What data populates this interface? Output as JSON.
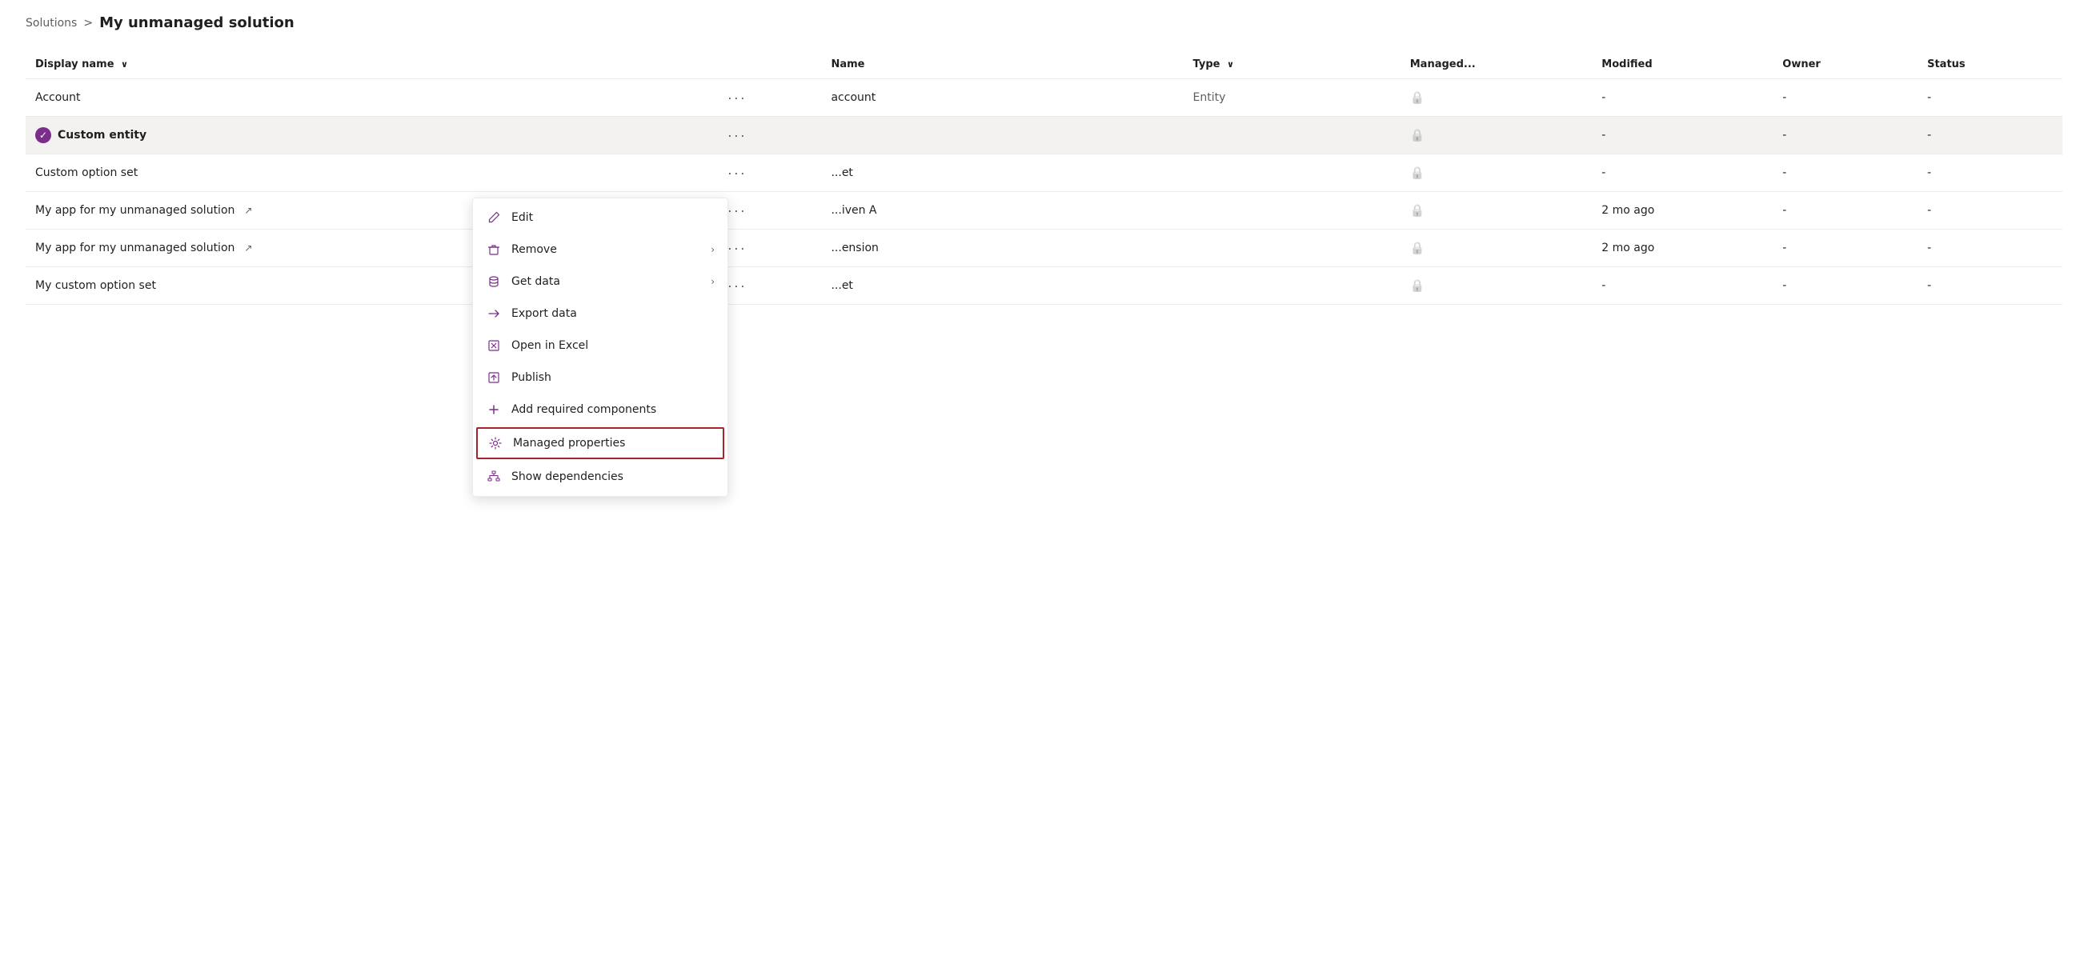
{
  "breadcrumb": {
    "solutions_label": "Solutions",
    "separator": ">",
    "current_label": "My unmanaged solution"
  },
  "table": {
    "columns": [
      {
        "id": "display_name",
        "label": "Display name",
        "sortable": true
      },
      {
        "id": "dots",
        "label": ""
      },
      {
        "id": "name",
        "label": "Name"
      },
      {
        "id": "type",
        "label": "Type",
        "sortable": true
      },
      {
        "id": "managed",
        "label": "Managed..."
      },
      {
        "id": "modified",
        "label": "Modified"
      },
      {
        "id": "owner",
        "label": "Owner"
      },
      {
        "id": "status",
        "label": "Status"
      }
    ],
    "rows": [
      {
        "id": "row-account",
        "display_name": "Account",
        "has_external": false,
        "selected": false,
        "dots": "···",
        "name": "account",
        "type": "Entity",
        "managed_lock": true,
        "modified": "-",
        "owner": "-",
        "status": "-"
      },
      {
        "id": "row-custom-entity",
        "display_name": "Custom entity",
        "has_external": false,
        "selected": true,
        "dots": "···",
        "name": "",
        "type": "",
        "managed_lock": true,
        "modified": "-",
        "owner": "-",
        "status": "-"
      },
      {
        "id": "row-custom-option-set",
        "display_name": "Custom option set",
        "has_external": false,
        "selected": false,
        "dots": "···",
        "name": "...et",
        "type": "",
        "managed_lock": true,
        "modified": "-",
        "owner": "-",
        "status": "-"
      },
      {
        "id": "row-my-app-1",
        "display_name": "My app for my unmanaged solution",
        "has_external": true,
        "selected": false,
        "dots": "···",
        "name": "...iven A",
        "type": "",
        "managed_lock": true,
        "modified": "2 mo ago",
        "owner": "-",
        "status": "-"
      },
      {
        "id": "row-my-app-2",
        "display_name": "My app for my unmanaged solution",
        "has_external": true,
        "selected": false,
        "dots": "···",
        "name": "...ension",
        "type": "",
        "managed_lock": true,
        "modified": "2 mo ago",
        "owner": "-",
        "status": "-"
      },
      {
        "id": "row-my-custom-option-set",
        "display_name": "My custom option set",
        "has_external": false,
        "selected": false,
        "dots": "···",
        "name": "...et",
        "type": "",
        "managed_lock": true,
        "modified": "-",
        "owner": "-",
        "status": "-"
      }
    ]
  },
  "context_menu": {
    "items": [
      {
        "id": "edit",
        "label": "Edit",
        "icon": "edit",
        "has_arrow": false,
        "highlighted": false
      },
      {
        "id": "remove",
        "label": "Remove",
        "icon": "trash",
        "has_arrow": true,
        "highlighted": false
      },
      {
        "id": "get-data",
        "label": "Get data",
        "icon": "database",
        "has_arrow": true,
        "highlighted": false
      },
      {
        "id": "export-data",
        "label": "Export data",
        "icon": "export",
        "has_arrow": false,
        "highlighted": false
      },
      {
        "id": "open-excel",
        "label": "Open in Excel",
        "icon": "excel",
        "has_arrow": false,
        "highlighted": false
      },
      {
        "id": "publish",
        "label": "Publish",
        "icon": "publish",
        "has_arrow": false,
        "highlighted": false
      },
      {
        "id": "add-required",
        "label": "Add required components",
        "icon": "plus",
        "has_arrow": false,
        "highlighted": false
      },
      {
        "id": "managed-properties",
        "label": "Managed properties",
        "icon": "gear",
        "has_arrow": false,
        "highlighted": true
      },
      {
        "id": "show-dependencies",
        "label": "Show dependencies",
        "icon": "hierarchy",
        "has_arrow": false,
        "highlighted": false
      }
    ]
  },
  "icons": {
    "edit": "✏",
    "trash": "🗑",
    "database": "🗄",
    "export": "⇥",
    "excel": "⊞",
    "publish": "⊡",
    "plus": "+",
    "gear": "⚙",
    "hierarchy": "⬡",
    "lock": "🔒",
    "check": "✓",
    "external_link": "↗",
    "chevron_right": "›",
    "sort_down": "∨"
  },
  "accent_color": "#7b2d8b"
}
